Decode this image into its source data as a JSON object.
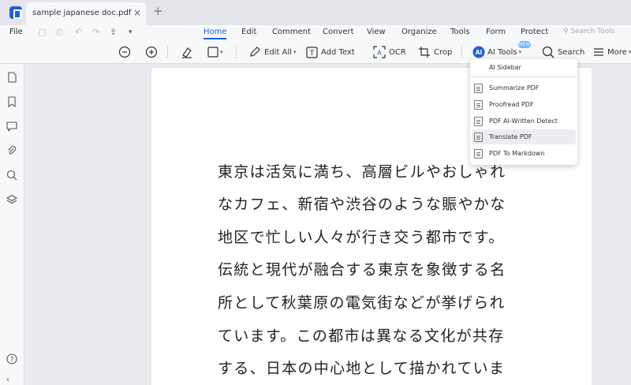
{
  "tab": {
    "title": "sample japanese doc.pdf",
    "close": "×",
    "new": "+"
  },
  "menubar": {
    "file": "File",
    "items": [
      "Home",
      "Edit",
      "Comment",
      "Convert",
      "View",
      "Organize",
      "Tools",
      "Form",
      "Protect"
    ],
    "active": "Home",
    "search_tools": "Search Tools"
  },
  "toolbar": {
    "edit_all": "Edit All",
    "add_text": "Add Text",
    "ocr": "OCR",
    "crop": "Crop",
    "ai_tools": "AI Tools",
    "search": "Search",
    "more": "More",
    "new_badge": "NEW"
  },
  "ai_menu": {
    "sidebar": "AI Sidebar",
    "items": [
      "Summarize PDF",
      "Proofread PDF",
      "PDF AI-Written Detect",
      "Translate PDF",
      "PDF To Markdown"
    ],
    "highlighted": "Translate PDF"
  },
  "document": {
    "lines": [
      "東京は活気に満ち、高層ビルやおしゃれ",
      "なカフェ、新宿や渋谷のような賑やかな",
      "地区で忙しい人々が行き交う都市です。",
      "伝統と現代が融合する東京を象徴する名",
      "所として秋葉原の電気街などが挙げられ",
      "ています。この都市は異なる文化が共存",
      "する、日本の中心地として描かれていま"
    ]
  },
  "colors": {
    "accent": "#1f5fe0",
    "badge": "#6fb7ff"
  }
}
